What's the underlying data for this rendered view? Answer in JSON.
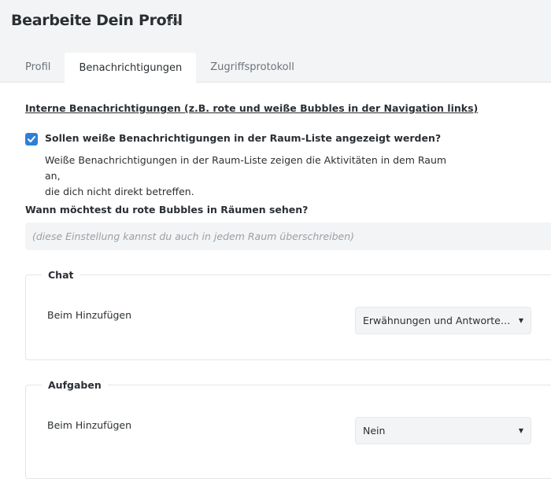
{
  "header": {
    "title": "Bearbeite Dein Profil",
    "more_icon": "more-horizontal-icon"
  },
  "tabs": [
    {
      "label": "Profil",
      "active": false
    },
    {
      "label": "Benachrichtigungen",
      "active": true
    },
    {
      "label": "Zugriffsprotokoll",
      "active": false
    }
  ],
  "internal": {
    "heading": "Interne Benachrichtigungen (z.B. rote und weiße Bubbles in der Navigation links)",
    "white_checkbox": {
      "checked": true,
      "label": "Sollen weiße Benachrichtigungen in der Raum-Liste angezeigt werden?",
      "desc_line1": "Weiße Benachrichtigungen in der Raum-Liste zeigen die Aktivitäten in dem Raum an,",
      "desc_line2": "die dich nicht direkt betreffen."
    },
    "red_question": "Wann möchtest du rote Bubbles in Räumen sehen?",
    "red_hint": "(diese Einstellung kannst du auch in jedem Raum überschreiben)"
  },
  "groups": {
    "chat": {
      "legend": "Chat",
      "row_label": "Beim Hinzufügen",
      "select_value": "Erwähnungen und Antworten auf mich"
    },
    "tasks": {
      "legend": "Aufgaben",
      "row_label": "Beim Hinzufügen",
      "select_value": "Nein"
    }
  },
  "colors": {
    "accent": "#2f7fd8",
    "header_bg": "#f3f4f5"
  }
}
